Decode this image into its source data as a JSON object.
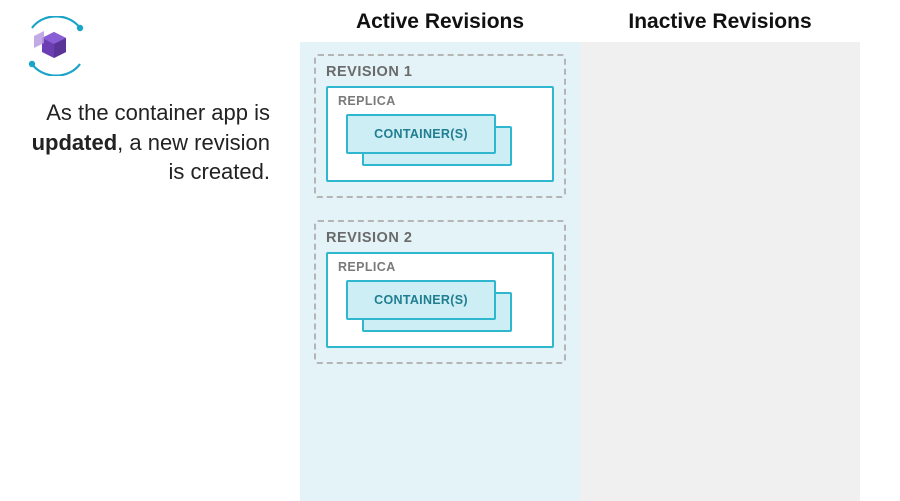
{
  "description": {
    "prefix": "As the container app is ",
    "emph": "updated",
    "suffix": ", a new revision is created."
  },
  "columns": {
    "active": {
      "heading": "Active Revisions",
      "revisions": [
        {
          "label": "REVISION 1",
          "replica_label": "REPLICA",
          "container_label": "CONTAINER(S)"
        },
        {
          "label": "REVISION 2",
          "replica_label": "REPLICA",
          "container_label": "CONTAINER(S)"
        }
      ]
    },
    "inactive": {
      "heading": "Inactive Revisions",
      "revisions": []
    }
  },
  "icons": {
    "logo": "azure-container-apps-icon"
  },
  "colors": {
    "panel_active_bg": "#e3f3f8",
    "panel_inactive_bg": "#f0f0f0",
    "box_border": "#2fb7cf",
    "box_fill": "#cdeef5",
    "dash_border": "#b5b5b5"
  }
}
